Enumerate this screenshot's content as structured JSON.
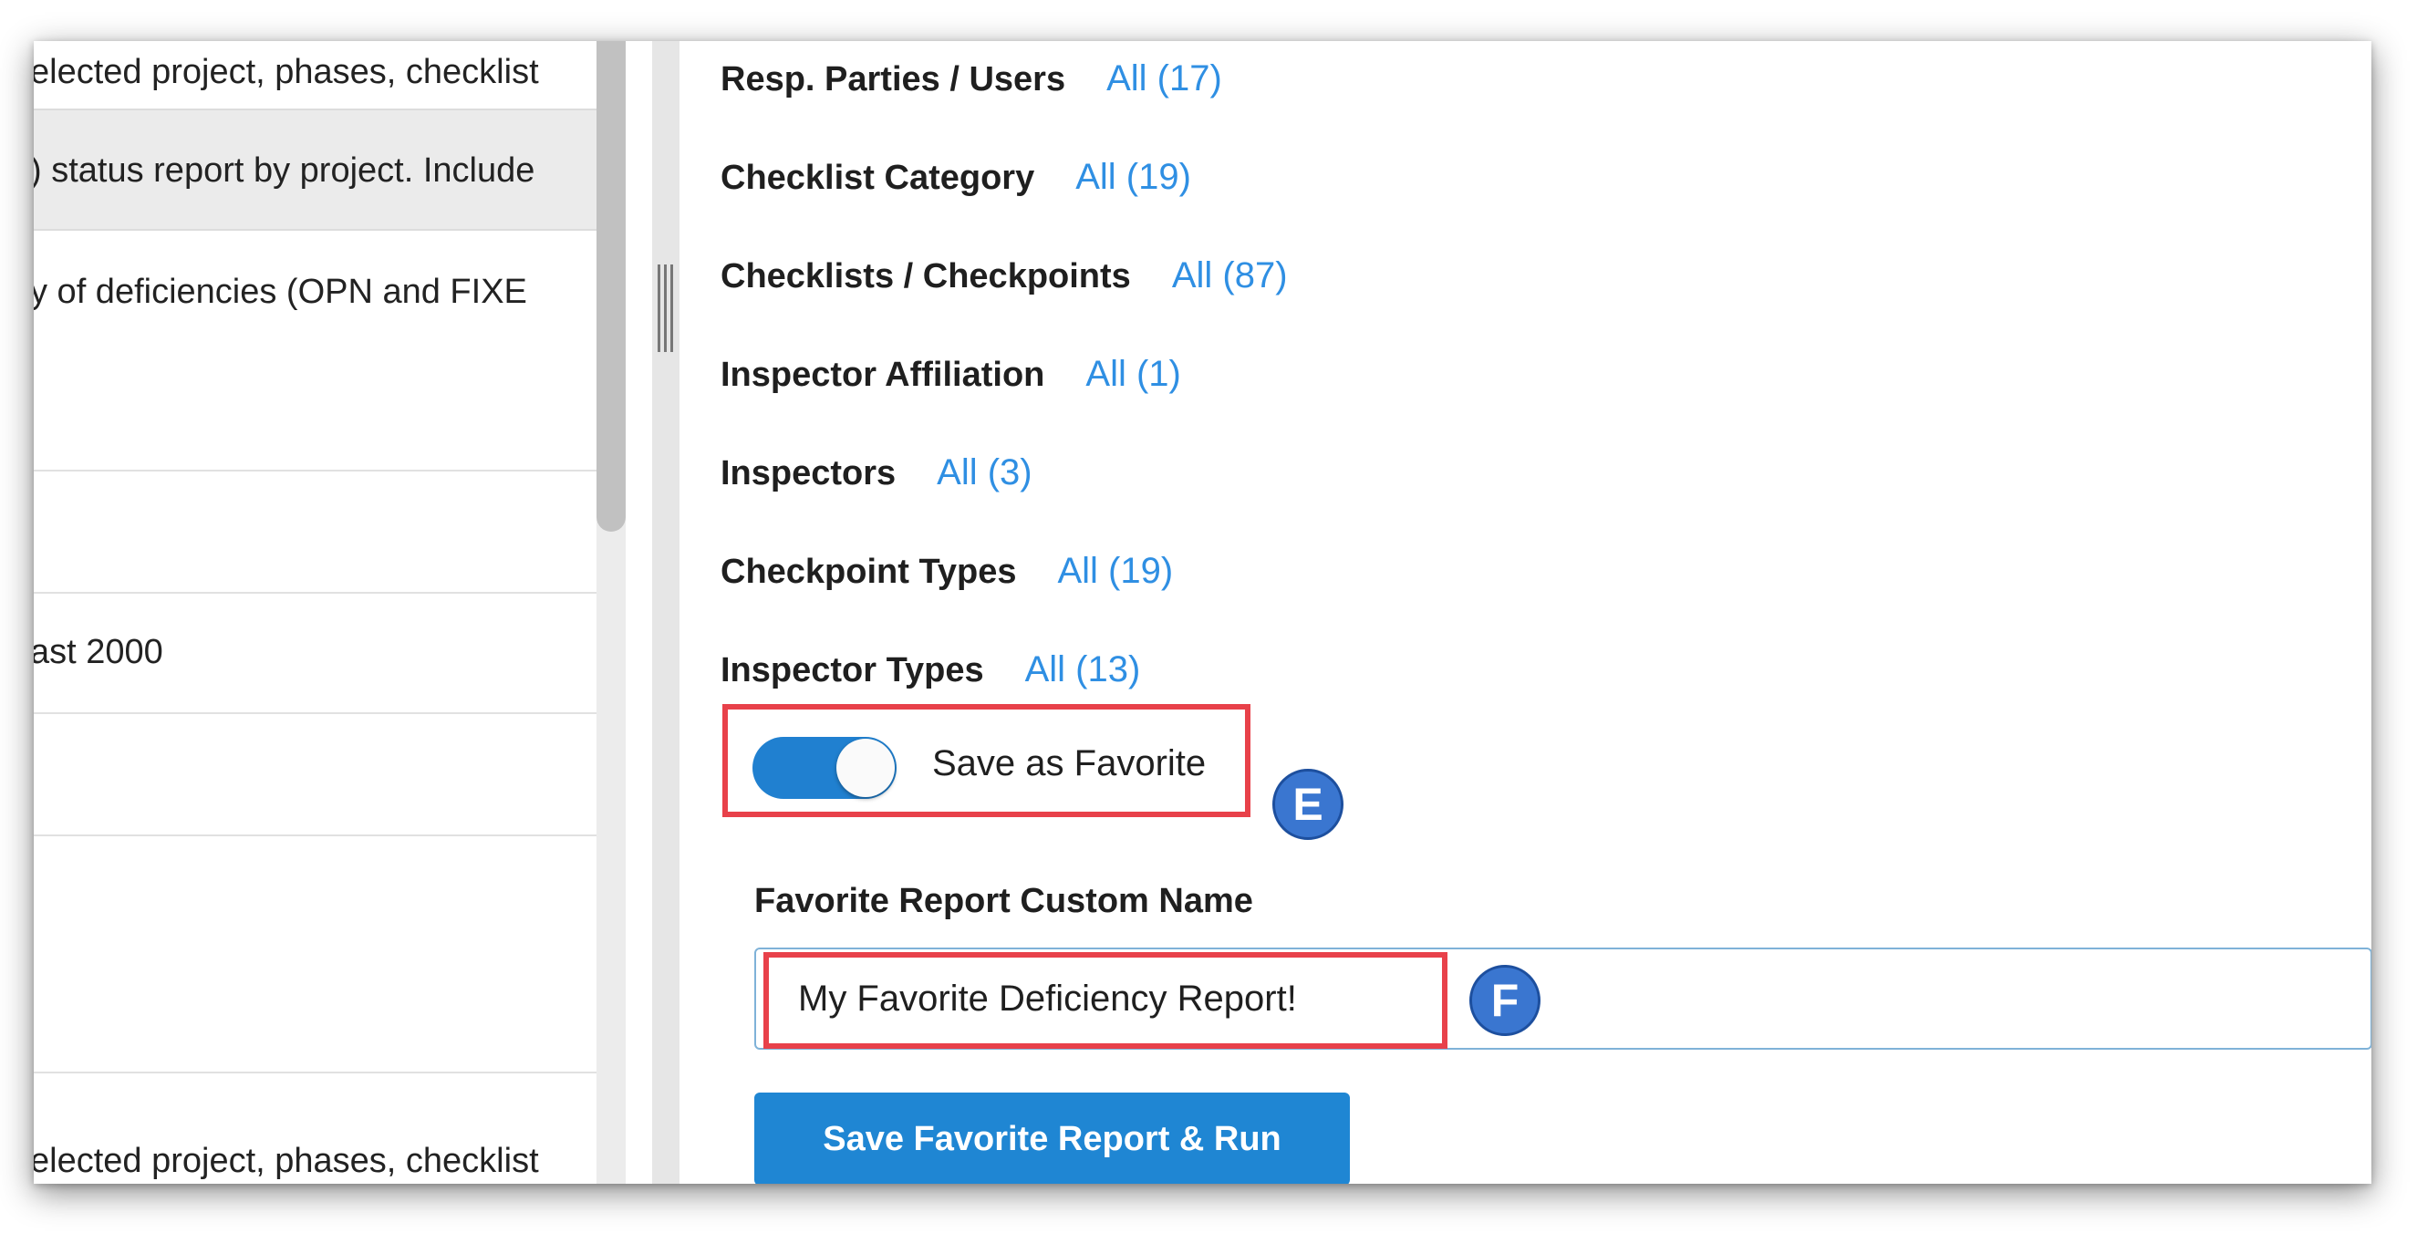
{
  "left_list": {
    "rows": [
      {
        "text": "elected project, phases, checklist"
      },
      {
        "text": ") status report by project. Include"
      },
      {
        "text": "y of deficiencies (OPN and FIXE"
      },
      {
        "text": "ast 2000"
      },
      {
        "text": "elected project, phases, checklist"
      }
    ]
  },
  "filters": [
    {
      "label": "Resp. Parties / Users",
      "value": "All (17)"
    },
    {
      "label": "Checklist Category",
      "value": "All (19)"
    },
    {
      "label": "Checklists / Checkpoints",
      "value": "All (87)"
    },
    {
      "label": "Inspector Affiliation",
      "value": "All (1)"
    },
    {
      "label": "Inspectors",
      "value": "All (3)"
    },
    {
      "label": "Checkpoint Types",
      "value": "All (19)"
    },
    {
      "label": "Inspector Types",
      "value": "All (13)"
    }
  ],
  "favorite": {
    "toggle_label": "Save as Favorite",
    "toggle_on": true,
    "badge_e": "E",
    "name_label": "Favorite Report Custom Name",
    "name_value": "My Favorite Deficiency Report!",
    "badge_f": "F",
    "run_button": "Save Favorite Report & Run"
  },
  "colors": {
    "link": "#2f8fe3",
    "toggle_on": "#2080d0",
    "highlight": "#e8414a",
    "badge": "#3a76d0",
    "button": "#1f86d3"
  }
}
